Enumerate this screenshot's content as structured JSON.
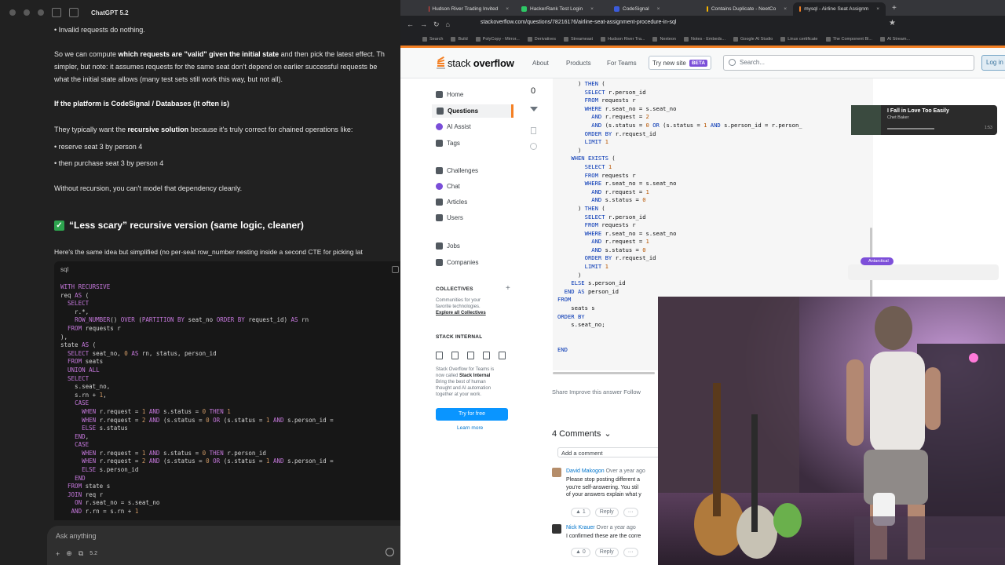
{
  "chat": {
    "model": "ChatGPT 5.2",
    "lines": [
      {
        "bullet": "• ",
        "text": "Invalid requests do nothing."
      },
      {
        "pre": "So we can compute ",
        "bold": "which requests are \"valid\" given the initial state",
        "post": " and then pick the latest effect. Th"
      },
      {
        "text": "simpler, but note: it assumes requests for the same seat don't depend on earlier successful requests be"
      },
      {
        "text": "what the initial state allows (many test sets still work this way, but not all)."
      },
      {
        "bold": "If the platform is CodeSignal / Databases (it often is)"
      },
      {
        "pre": "They typically want the ",
        "bold": "recursive solution",
        "post": " because it's truly correct for chained operations like:"
      },
      {
        "text": "• reserve seat 3 by person 4"
      },
      {
        "text": "• then purchase seat 3 by person 4"
      },
      {
        "text": "Without recursion, you can't model that dependency cleanly."
      }
    ],
    "heading": "“Less scary” recursive version (same logic, cleaner)",
    "intro": "Here's the same idea but simplified (no per-seat row_number nesting inside a second CTE for picking lat",
    "code_lang": "sql",
    "code": "WITH RECURSIVE\nreq AS (\n  SELECT\n    r.*,\n    ROW_NUMBER() OVER (PARTITION BY seat_no ORDER BY request_id) AS rn\n  FROM requests r\n),\nstate AS (\n  SELECT seat_no, 0 AS rn, status, person_id\n  FROM seats\n  UNION ALL\n  SELECT\n    s.seat_no,\n    s.rn + 1,\n    CASE\n      WHEN r.request = 1 AND s.status = 0 THEN 1\n      WHEN r.request = 2 AND (s.status = 0 OR (s.status = 1 AND s.person_id =\n      ELSE s.status\n    END,\n    CASE\n      WHEN r.request = 1 AND s.status = 0 THEN r.person_id\n      WHEN r.request = 2 AND (s.status = 0 OR (s.status = 1 AND s.person_id =\n      ELSE s.person_id\n    END\n  FROM state s\n  JOIN req r\n    ON r.seat_no = s.seat_no\n   AND r.rn = s.rn + 1",
    "ask_placeholder": "Ask anything",
    "ask_tools": [
      "+",
      "⊕",
      "⧉",
      "5.2"
    ]
  },
  "browser": {
    "tabs": [
      {
        "label": "Hudson River Trading Invited",
        "color": "#e8453c"
      },
      {
        "label": "HackerRank Test Login",
        "color": "#2ec866"
      },
      {
        "label": "CodeSignal",
        "color": "#3b5bdb"
      },
      {
        "label": "Contains Duplicate - NeetCo",
        "color": "#f5b400"
      },
      {
        "label": "mysql - Airline Seat Assignm",
        "color": "#f48024",
        "active": true
      }
    ],
    "url": "stackoverflow.com/questions/78216176/airline-seat-assignment-procedure-in-sql",
    "bookmarks": [
      "Search",
      "Build",
      "PolyCopy - Mirror...",
      "Derivatives",
      "Streameast",
      "Hudson River Tra...",
      "Nexteon",
      "Notes - Embeds...",
      "Google AI Studio",
      "Linux certificate",
      "The Component Bl...",
      "AI Stream..."
    ]
  },
  "so": {
    "logo": {
      "pre": "stack ",
      "bold": "overflow"
    },
    "nav": [
      "About",
      "Products",
      "For Teams"
    ],
    "try_new": "Try new site",
    "beta": "BETA",
    "search_placeholder": "Search...",
    "login": "Log in",
    "left": {
      "home": "Home",
      "questions": "Questions",
      "ai_assist": "AI Assist",
      "tags": "Tags",
      "challenges": "Challenges",
      "chat": "Chat",
      "articles": "Articles",
      "users": "Users",
      "jobs": "Jobs",
      "companies": "Companies",
      "collectives": "COLLECTIVES",
      "collectives_desc1": "Communities for your",
      "collectives_desc2": "favorite technologies.",
      "explore": "Explore all Collectives",
      "internal": "STACK INTERNAL",
      "internal_desc1": "Stack Overflow for Teams is",
      "internal_desc2a": "now called ",
      "internal_desc2b": "Stack Internal",
      "internal_desc3": "Bring the best of human",
      "internal_desc4": "thought and AI automation",
      "internal_desc5": "together at your work.",
      "try_free": "Try for free",
      "learn_more": "Learn more"
    },
    "vote_count": "0",
    "answer_code": "      ) THEN (\n        SELECT r.person_id\n        FROM requests r\n        WHERE r.seat_no = s.seat_no\n          AND r.request = 2\n          AND (s.status = 0 OR (s.status = 1 AND s.person_id = r.person_\n        ORDER BY r.request_id\n        LIMIT 1\n      )\n    WHEN EXISTS (\n        SELECT 1\n        FROM requests r\n        WHERE r.seat_no = s.seat_no\n          AND r.request = 1\n          AND s.status = 0\n      ) THEN (\n        SELECT r.person_id\n        FROM requests r\n        WHERE r.seat_no = s.seat_no\n          AND r.request = 1\n          AND s.status = 0\n        ORDER BY r.request_id\n        LIMIT 1\n      )\n    ELSE s.person_id\n  END AS person_id\nFROM\n    seats s\nORDER BY\n    s.seat_no;\n\n\nEND",
    "actions": "Share   Improve this answer   Follow",
    "comments_title": "4 Comments",
    "add_comment": "Add a comment",
    "comments": [
      {
        "author": "David Makogon",
        "when": "Over a year ago",
        "lines": [
          "Please stop posting different a",
          "you're self-answering. You stil",
          "of your answers explain what y"
        ],
        "votes": "1",
        "reply": "Reply"
      },
      {
        "author": "Nick Krauer",
        "when": "Over a year ago",
        "lines": [
          "I confirmed these are the corre"
        ],
        "votes": "0",
        "reply": "Reply"
      }
    ],
    "music": {
      "title": "I Fall in Love Too Easily",
      "artist": "Chet Baker",
      "elapsed": "1:53"
    },
    "bubble": "Antarctical"
  }
}
